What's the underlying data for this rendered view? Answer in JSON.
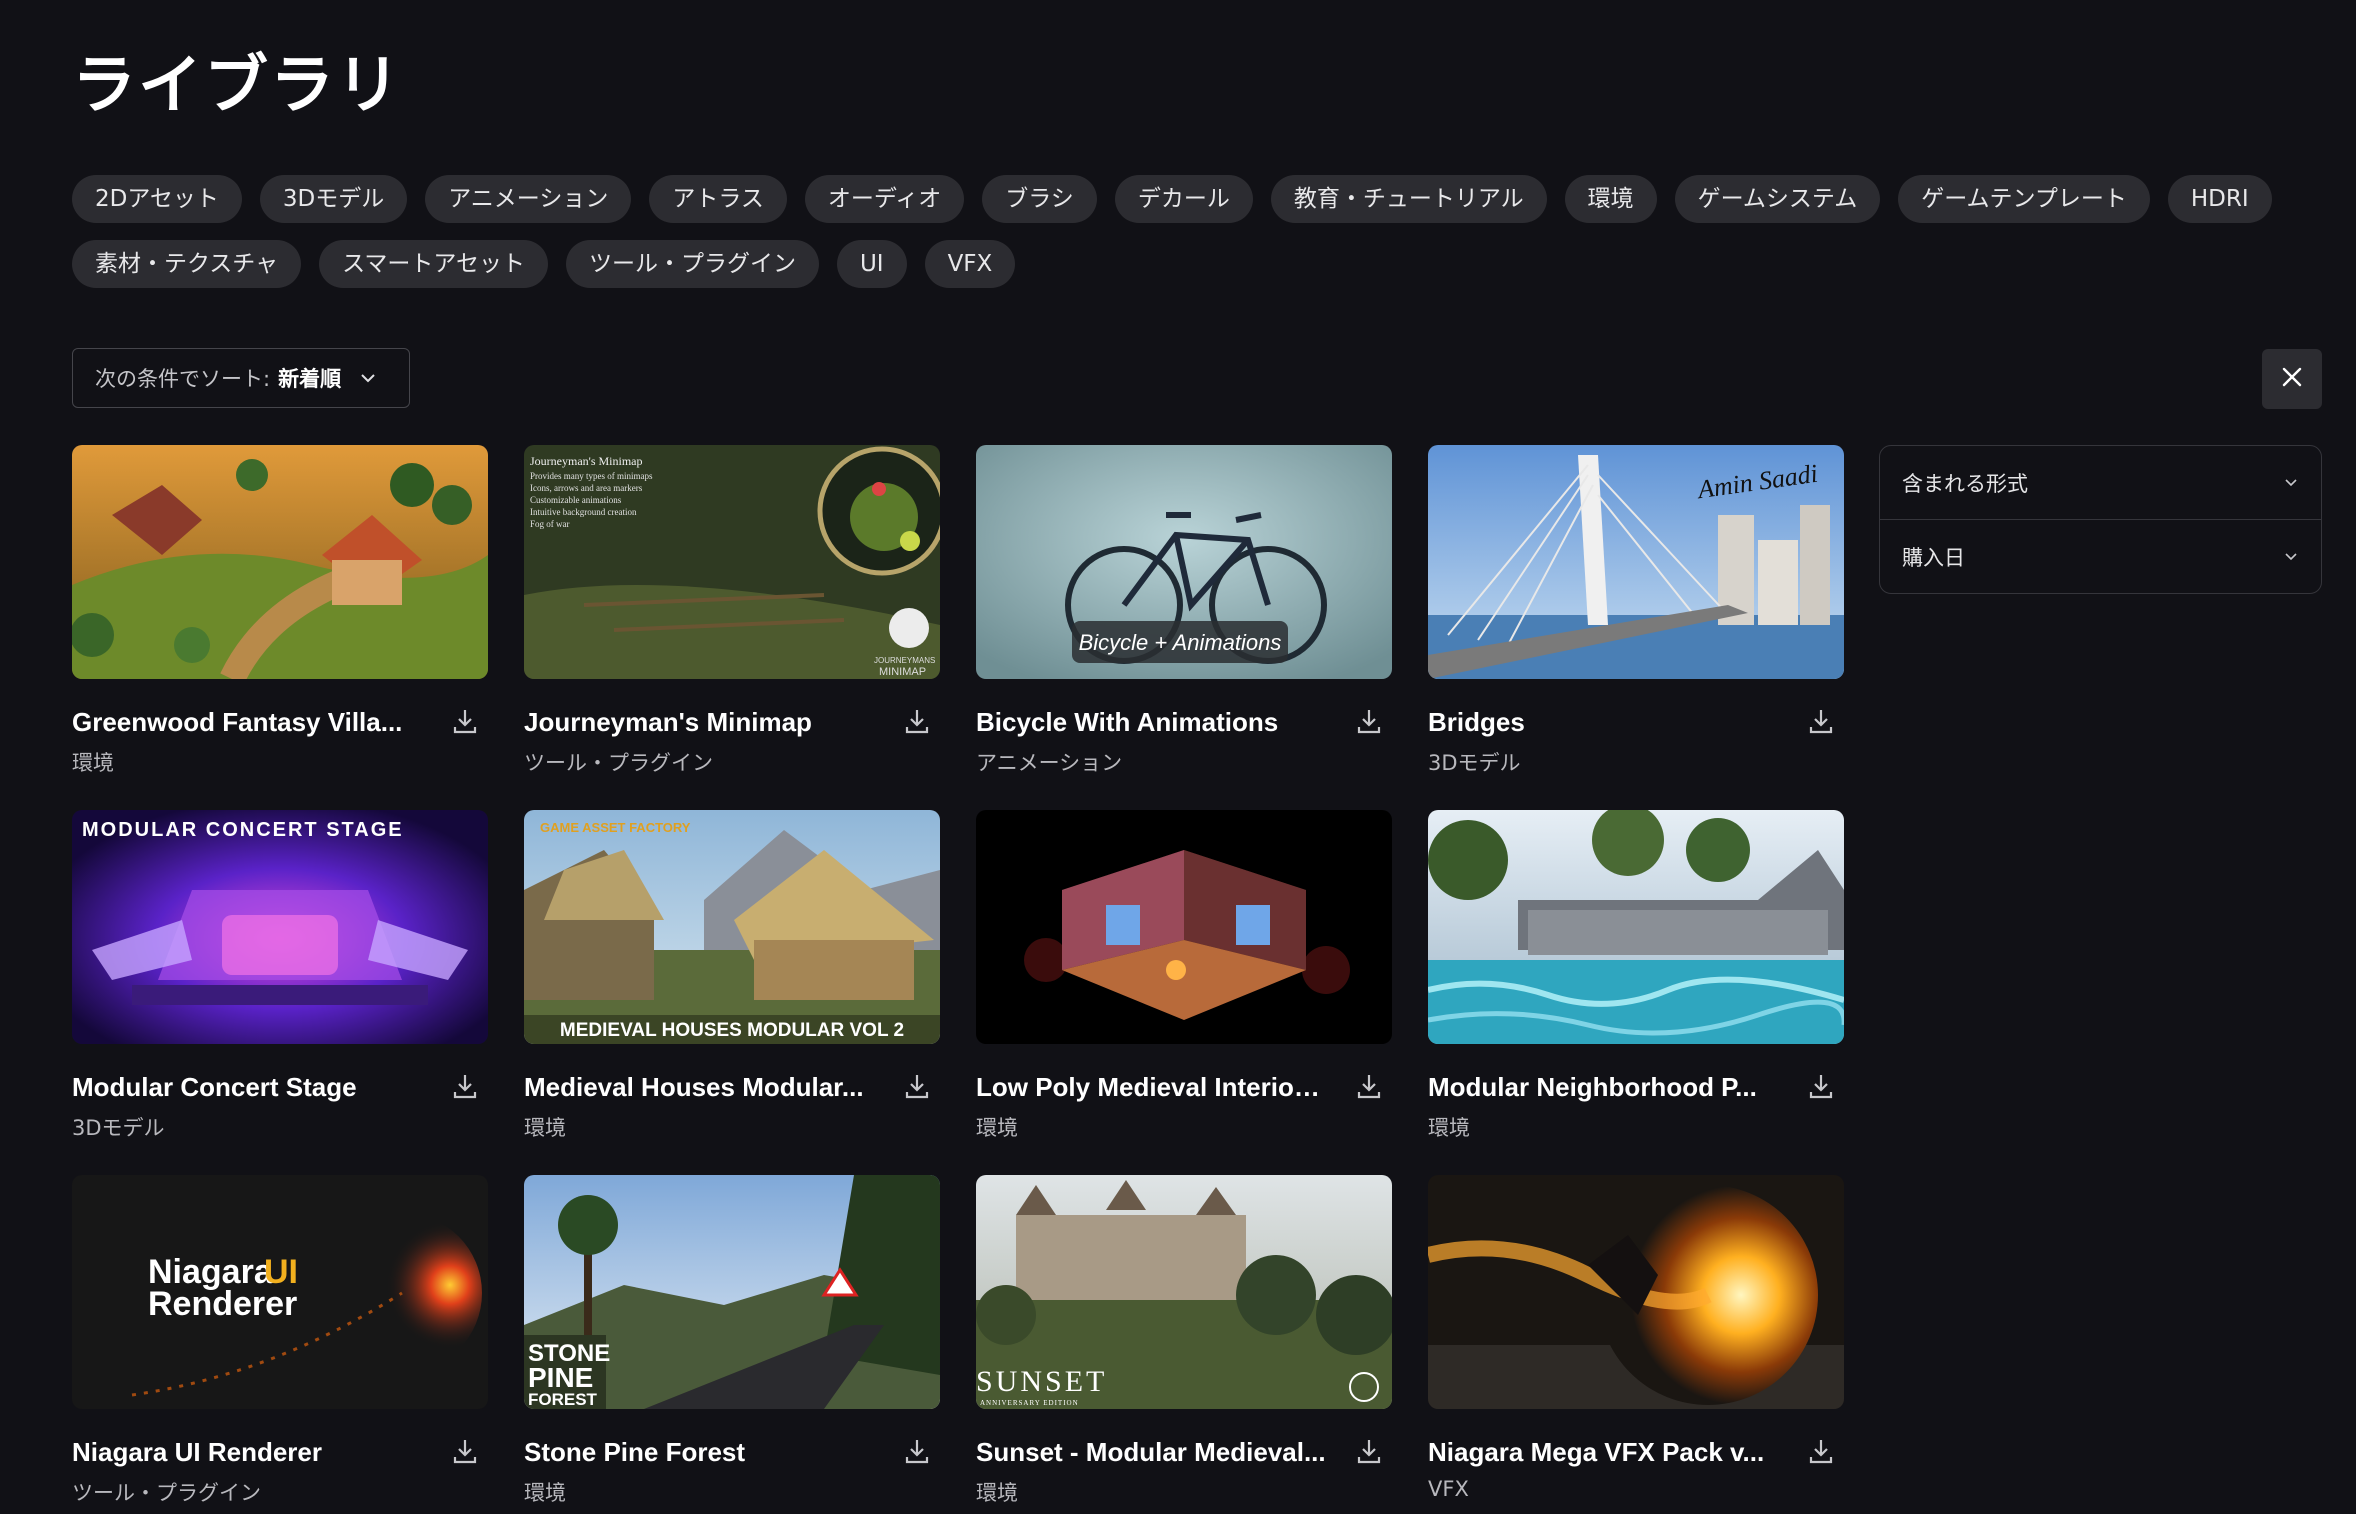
{
  "page": {
    "title": "ライブラリ"
  },
  "categories": [
    "2Dアセット",
    "3Dモデル",
    "アニメーション",
    "アトラス",
    "オーディオ",
    "ブラシ",
    "デカール",
    "教育・チュートリアル",
    "環境",
    "ゲームシステム",
    "ゲームテンプレート",
    "HDRI",
    "素材・テクスチャ",
    "スマートアセット",
    "ツール・プラグイン",
    "UI",
    "VFX"
  ],
  "sort": {
    "label": "次の条件でソート:",
    "value": "新着順",
    "icon": "chevron-down-icon"
  },
  "close_button": {
    "icon": "close-icon"
  },
  "filters": [
    {
      "label": "含まれる形式",
      "icon": "chevron-down-icon"
    },
    {
      "label": "購入日",
      "icon": "chevron-down-icon"
    }
  ],
  "products": [
    {
      "title": "Greenwood Fantasy Villa...",
      "category": "環境"
    },
    {
      "title": "Journeyman's Minimap",
      "category": "ツール・プラグイン",
      "thumb_text": [
        "Journeyman's Minimap",
        "Provides many types of minimaps",
        "Icons, arrows and area markers",
        "Customizable animations",
        "Intuitive background creation",
        "Fog of war"
      ],
      "thumb_logo": [
        "JOURNEYMANS",
        "MINIMAP"
      ]
    },
    {
      "title": "Bicycle With Animations",
      "category": "アニメーション",
      "thumb_text": "Bicycle + Animations"
    },
    {
      "title": "Bridges",
      "category": "3Dモデル",
      "thumb_text": "Amin Saadi"
    },
    {
      "title": "Modular Concert Stage",
      "category": "3Dモデル",
      "thumb_text": "MODULAR CONCERT STAGE"
    },
    {
      "title": "Medieval Houses Modular...",
      "category": "環境",
      "thumb_text": "MEDIEVAL HOUSES MODULAR VOL 2",
      "thumb_logo": "GAME ASSET FACTORY"
    },
    {
      "title": "Low Poly Medieval Interior ...",
      "category": "環境"
    },
    {
      "title": "Modular Neighborhood P...",
      "category": "環境"
    },
    {
      "title": "Niagara UI Renderer",
      "category": "ツール・プラグイン",
      "thumb_text": [
        "Niagara",
        "UI",
        "Renderer"
      ]
    },
    {
      "title": "Stone Pine Forest",
      "category": "環境",
      "thumb_text": [
        "STONE",
        "PINE",
        "FOREST"
      ]
    },
    {
      "title": "Sunset - Modular Medieval...",
      "category": "環境",
      "thumb_text": [
        "SUNSET",
        "ANNIVERSARY EDITION"
      ]
    },
    {
      "title": "Niagara Mega VFX Pack v...",
      "category": "VFX"
    }
  ],
  "icons": {
    "download": "download-icon"
  },
  "colors": {
    "background": "#111116",
    "chip": "#2c2c31",
    "text": "#ffffff",
    "muted": "#b8b8bd"
  }
}
